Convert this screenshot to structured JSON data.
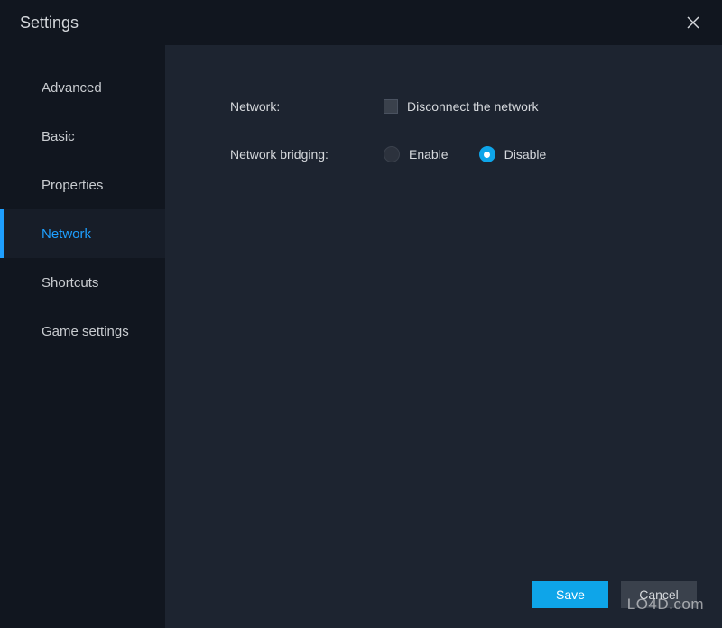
{
  "titlebar": {
    "title": "Settings"
  },
  "sidebar": {
    "items": [
      {
        "label": "Advanced",
        "active": false
      },
      {
        "label": "Basic",
        "active": false
      },
      {
        "label": "Properties",
        "active": false
      },
      {
        "label": "Network",
        "active": true
      },
      {
        "label": "Shortcuts",
        "active": false
      },
      {
        "label": "Game settings",
        "active": false
      }
    ]
  },
  "form": {
    "network": {
      "label": "Network:",
      "checkbox_label": "Disconnect the network",
      "checked": false
    },
    "bridging": {
      "label": "Network bridging:",
      "options": [
        {
          "label": "Enable",
          "checked": false
        },
        {
          "label": "Disable",
          "checked": true
        }
      ]
    }
  },
  "buttons": {
    "save": "Save",
    "cancel": "Cancel"
  },
  "watermark": "LO4D.com"
}
